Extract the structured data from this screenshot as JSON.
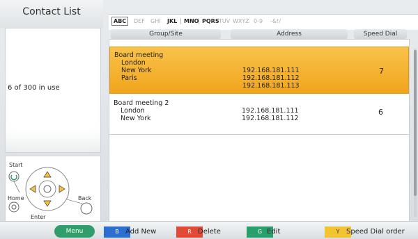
{
  "left": {
    "title": "Contact List",
    "usage": "6 of 300 in use",
    "nav": {
      "start": "Start",
      "home": "Home",
      "back": "Back",
      "enter": "Enter"
    }
  },
  "tabs": [
    {
      "label": "ABC",
      "state": "active"
    },
    {
      "label": "DEF",
      "state": "disabled"
    },
    {
      "label": "GHI",
      "state": "disabled"
    },
    {
      "label": "JKL",
      "state": "enabled"
    },
    {
      "label": "MNO",
      "state": "enabled"
    },
    {
      "label": "PQRS",
      "state": "enabled"
    },
    {
      "label": "TUV",
      "state": "disabled"
    },
    {
      "label": "WXYZ",
      "state": "disabled"
    },
    {
      "label": "0-9",
      "state": "disabled"
    },
    {
      "label": "-&!/",
      "state": "disabled"
    }
  ],
  "columns": {
    "group": "Group/Site",
    "address": "Address",
    "speed": "Speed Dial"
  },
  "rows": [
    {
      "group": "Board meeting",
      "sites": [
        "London",
        "New York",
        "Paris"
      ],
      "addresses": [
        "192.168.181.111",
        "192.168.181.112",
        "192.168.181.113"
      ],
      "speed": "7",
      "selected": true
    },
    {
      "group": "Board meeting 2",
      "sites": [
        "London",
        "New York"
      ],
      "addresses": [
        "192.168.181.111",
        "192.168.181.112"
      ],
      "speed": "6",
      "selected": false
    }
  ],
  "bottom": {
    "menu": "Menu",
    "keys": [
      {
        "key": "B",
        "label": "Add New",
        "color": "#2c6fd1"
      },
      {
        "key": "R",
        "label": "Delete",
        "color": "#e24a36"
      },
      {
        "key": "G",
        "label": "Edit",
        "color": "#29a06b"
      },
      {
        "key": "Y",
        "label": "Speed Dial order",
        "color": "#f2c431"
      }
    ]
  },
  "colors": {
    "selected_row": "#f0a51c",
    "accent_green": "#2f9e6b"
  }
}
